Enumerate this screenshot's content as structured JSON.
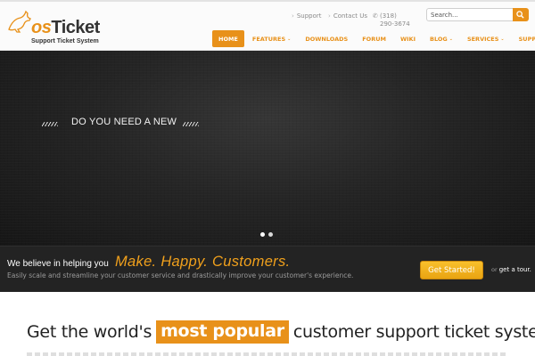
{
  "brand": {
    "logo_os": "os",
    "logo_ticket": "Ticket",
    "tagline": "Support Ticket System",
    "accent_color": "#e8911a"
  },
  "top_links": {
    "support": "Support",
    "contact": "Contact Us",
    "phone": "(318) 290-3674"
  },
  "search": {
    "placeholder": "Search...",
    "button_icon": "search-icon"
  },
  "nav": {
    "home": "HOME",
    "features": "FEATURES",
    "downloads": "DOWNLOADS",
    "forum": "FORUM",
    "wiki": "WIKI",
    "blog": "BLOG",
    "services": "SERVICES",
    "support": "SUPPORT",
    "dropdown_icon": "chevron-down-icon"
  },
  "hero": {
    "headline": "DO YOU NEED A NEW",
    "slide_count": 2,
    "active_slide": 1
  },
  "cta": {
    "lead": "We believe in helping you",
    "slogan": "Make. Happy. Customers.",
    "subtext": "Easily scale and streamline your customer service and drastically improve your customer's experience.",
    "button": "Get Started!",
    "or_text": "or",
    "tour_link": "get a tour."
  },
  "headline": {
    "before": "Get the world's",
    "highlight": "most popular",
    "after": "customer support ticket system"
  }
}
